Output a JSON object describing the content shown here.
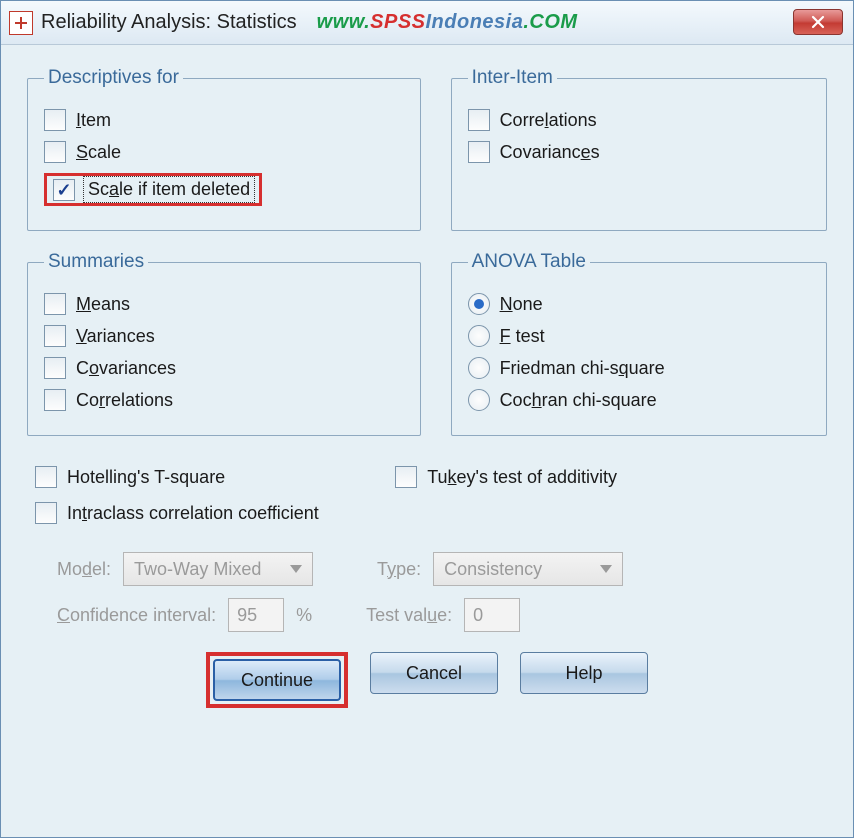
{
  "window": {
    "title": "Reliability Analysis: Statistics"
  },
  "watermark": {
    "www": "www.",
    "spss": "SPSS",
    "indo": "Indonesia",
    "com": ".COM"
  },
  "groups": {
    "descriptives": {
      "legend": "Descriptives for",
      "item": {
        "pre": "",
        "mn": "I",
        "post": "tem",
        "checked": false
      },
      "scale": {
        "pre": "",
        "mn": "S",
        "post": "cale",
        "checked": false
      },
      "scale_if_deleted": {
        "pre": "Sc",
        "mn": "a",
        "post": "le if item deleted",
        "checked": true
      }
    },
    "inter_item": {
      "legend": "Inter-Item",
      "correlations": {
        "pre": "Corre",
        "mn": "l",
        "post": "ations",
        "checked": false
      },
      "covariances": {
        "pre": "Covarianc",
        "mn": "e",
        "post": "s",
        "checked": false
      }
    },
    "summaries": {
      "legend": "Summaries",
      "means": {
        "pre": "",
        "mn": "M",
        "post": "eans",
        "checked": false
      },
      "variances": {
        "pre": "",
        "mn": "V",
        "post": "ariances",
        "checked": false
      },
      "covariances": {
        "pre": "C",
        "mn": "o",
        "post": "variances",
        "checked": false
      },
      "correlations": {
        "pre": "Co",
        "mn": "r",
        "post": "relations",
        "checked": false
      }
    },
    "anova": {
      "legend": "ANOVA Table",
      "none": {
        "pre": "",
        "mn": "N",
        "post": "one",
        "checked": true
      },
      "f_test": {
        "pre": "",
        "mn": "F",
        "post": " test",
        "checked": false
      },
      "friedman": {
        "pre": "Friedman chi-s",
        "mn": "q",
        "post": "uare",
        "checked": false
      },
      "cochran": {
        "pre": "Coc",
        "mn": "h",
        "post": "ran chi-square",
        "checked": false
      }
    }
  },
  "loose": {
    "hotelling": {
      "pre": "Hotellin",
      "mn": "g",
      "post": "'s T-square",
      "checked": false
    },
    "tukey": {
      "pre": "Tu",
      "mn": "k",
      "post": "ey's test of additivity",
      "checked": false
    },
    "intraclass": {
      "pre": "In",
      "mn": "t",
      "post": "raclass correlation coefficient",
      "checked": false
    }
  },
  "disabled": {
    "model_label": {
      "pre": "Mo",
      "mn": "d",
      "post": "el:"
    },
    "model_value": "Two-Way Mixed",
    "type_label": {
      "pre": "T",
      "mn": "y",
      "post": "pe:"
    },
    "type_value": "Consistency",
    "ci_label": {
      "pre": "",
      "mn": "C",
      "post": "onfidence interval:"
    },
    "ci_value": "95",
    "ci_unit": "%",
    "test_label": {
      "pre": "Test val",
      "mn": "u",
      "post": "e:"
    },
    "test_value": "0"
  },
  "buttons": {
    "continue": "Continue",
    "cancel": "Cancel",
    "help": "Help"
  }
}
